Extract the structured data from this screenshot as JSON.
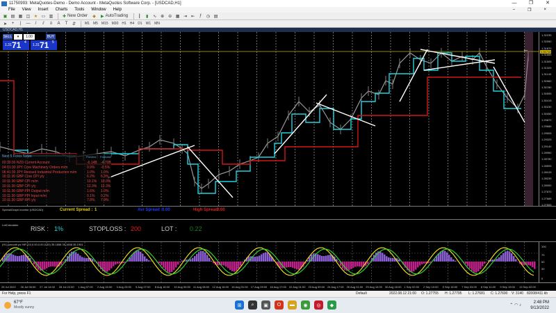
{
  "window": {
    "title": "11750993: MetaQuotes-Demo - Demo Account - MetaQuotes Software Corp. - [USDCAD,H1]",
    "controls": [
      "—",
      "❐",
      "✕"
    ]
  },
  "menu": [
    "File",
    "View",
    "Insert",
    "Charts",
    "Tools",
    "Window",
    "Help"
  ],
  "toolbar": {
    "new_order": "New Order",
    "auto_trading": "AutoTrading",
    "timeframes": [
      "M1",
      "M5",
      "M15",
      "M30",
      "H1",
      "H4",
      "D1",
      "W1",
      "MN"
    ]
  },
  "chart_tab": "USDCAD,H1",
  "trade_panel": {
    "sell_label": "SELL",
    "buy_label": "BUY",
    "lot": "1.00",
    "sell_small": "1.31",
    "sell_big": "71",
    "sell_sup": "4",
    "buy_small": "1.31",
    "buy_big": "71",
    "buy_sup": "5"
  },
  "price_axis": [
    "1.32235",
    "1.32050",
    "1.31870",
    "1.31685",
    "1.31505",
    "1.31325",
    "1.31140",
    "1.30960",
    "1.30780",
    "1.30595",
    "1.30415",
    "1.30230",
    "1.30050",
    "1.29870",
    "1.29685",
    "1.29505",
    "1.29325",
    "1.29140",
    "1.28960",
    "1.28780",
    "1.28595",
    "1.28415",
    "1.28235",
    "1.28050",
    "1.27870",
    "1.27685",
    "1.27505"
  ],
  "current_price": "1.31714",
  "news": {
    "title": "Next 5 Forex News",
    "col_prev": "Preview",
    "col_fore": "Forecast",
    "rows": [
      {
        "time": "02:30:30",
        "event": "NZD Current Account",
        "prev": "-6.14B",
        "fore": "-4.70B"
      },
      {
        "time": "04:01:30",
        "event": "JPY Core Machinery Orders m/m",
        "prev": "0.9%",
        "fore": "-0.5%"
      },
      {
        "time": "06:41:30",
        "event": "JPY Revised Industrial Production m/m",
        "prev": "1.0%",
        "fore": "1.0%"
      },
      {
        "time": "10:11:30",
        "event": "GBP Core CPI y/y",
        "prev": "6.2%",
        "fore": "6.3%"
      },
      {
        "time": "10:11:30",
        "event": "GBP CPI m/m",
        "prev": "10.1%",
        "fore": "10.0%"
      },
      {
        "time": "10:11:30",
        "event": "GBP CPI y/y",
        "prev": "12.3%",
        "fore": "12.3%"
      },
      {
        "time": "10:11:30",
        "event": "GBP PPI Output m/m",
        "prev": "1.6%",
        "fore": "1.0%"
      },
      {
        "time": "10:11:30",
        "event": "GBP PPI Input m/m",
        "prev": "0.1%",
        "fore": "0.2%"
      },
      {
        "time": "10:11:30",
        "event": "GBP RPI y/y",
        "prev": "7.8%",
        "fore": "7.9%"
      }
    ]
  },
  "spread_window": {
    "header": "SpreadGraph monitor (USDCAD)",
    "current_spread_label": "Current Spread :",
    "current_spread_value": "1",
    "avg_label": "Avr Spread :",
    "avg_value": "0.00",
    "high_label": "High Spread :",
    "high_value": "0.00"
  },
  "lot_window": {
    "header": "LotCalculator",
    "risk_label": "RISK :",
    "risk_value": "1%",
    "stoploss_label": "STOPLOSS :",
    "stoploss_value": "200",
    "lot_label": "LOT :",
    "lot_value": "0.22"
  },
  "osc_window": {
    "header": "(H1) smooth ps %R (10,0.00,0.00,0.00) 35.1658 35.1658 35.1901",
    "axis": [
      "100",
      "70",
      "50",
      "30",
      "0"
    ]
  },
  "time_axis": [
    "25 Jul 2022",
    "26 Jul 06:00",
    "27 Jul 14:00",
    "28 Jul 22:00",
    "1 Aug 07:00",
    "2 Aug 15:00",
    "3 Aug 23:00",
    "5 Aug 07:00",
    "8 Aug 16:00",
    "10 Aug 00:00",
    "11 Aug 08:00",
    "12 Aug 16:00",
    "16 Aug 01:00",
    "17 Aug 09:00",
    "18 Aug 17:00",
    "22 Aug 01:00",
    "23 Aug 09:00",
    "24 Aug 17:00",
    "26 Aug 01:00",
    "29 Aug 10:00",
    "30 Aug 18:00",
    "1 Sep 02:00",
    "2 Sep 10:00",
    "5 Sep 18:00",
    "7 Sep 03:00",
    "8 Sep 11:00",
    "9 Sep 19:00",
    "13 Sep 02:00"
  ],
  "status": {
    "help": "For Help, press F1",
    "profile": "Default",
    "datetime": "2022.08.12 21:00",
    "open": "O: 1.27755",
    "high": "H: 1.27795",
    "low": "L: 1.27681",
    "close": "C: 1.27690",
    "volume": "V: 3140",
    "traffic": "82008/411 kb"
  },
  "taskbar": {
    "temp": "67°F",
    "weather": "Mostly sunny",
    "time": "2:48 PM",
    "date": "9/13/2022"
  }
}
